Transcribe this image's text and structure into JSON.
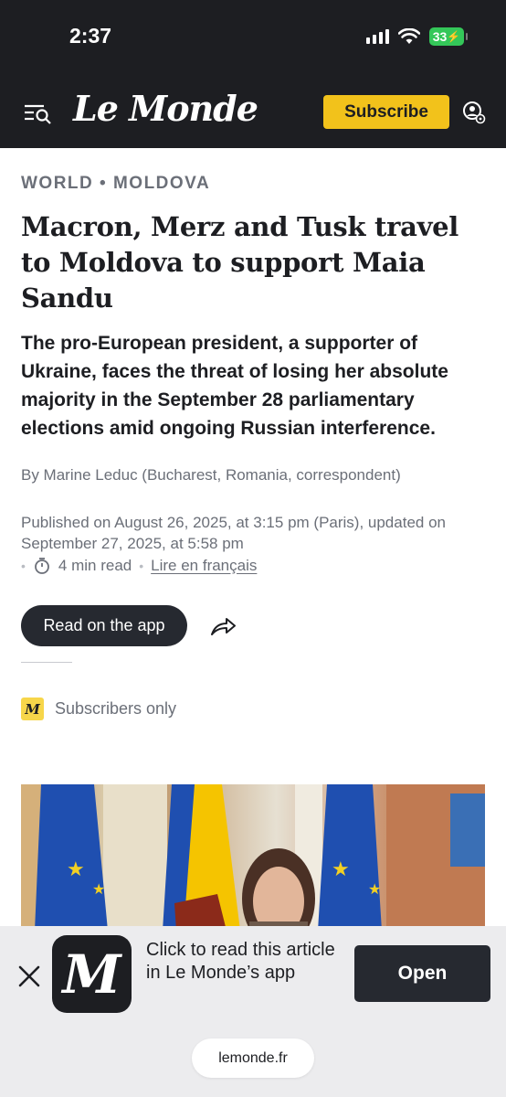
{
  "status_bar": {
    "time": "2:37",
    "battery": "33"
  },
  "header": {
    "logo": "Le Monde",
    "subscribe_label": "Subscribe",
    "menu_icon": "menu-search-icon",
    "account_icon": "account-settings-icon",
    "background": "#1d1e22",
    "accent": "#f2c21b"
  },
  "article": {
    "kicker": "WORLD • MOLDOVA",
    "headline": "Macron, Merz and Tusk travel to Moldova to support Maia Sandu",
    "dek": "The pro-European president, a supporter of Ukraine, faces the threat of losing her absolute majority in the September 28 parliamentary elections amid ongoing Russian interference.",
    "byline": "By Marine Leduc (Bucharest, Romania, correspondent)",
    "published": "Published on August 26, 2025, at 3:15 pm (Paris), updated on September 27, 2025, at 5:58 pm",
    "read_time": "4 min read",
    "lire_link": "Lire en français",
    "read_app_label": "Read on the app",
    "subscribers_badge": "M",
    "subscribers_label": "Subscribers only"
  },
  "banner": {
    "app_icon_letter": "M",
    "text": "Click to read this article in Le Monde’s app",
    "open_label": "Open",
    "url": "lemonde.fr"
  }
}
